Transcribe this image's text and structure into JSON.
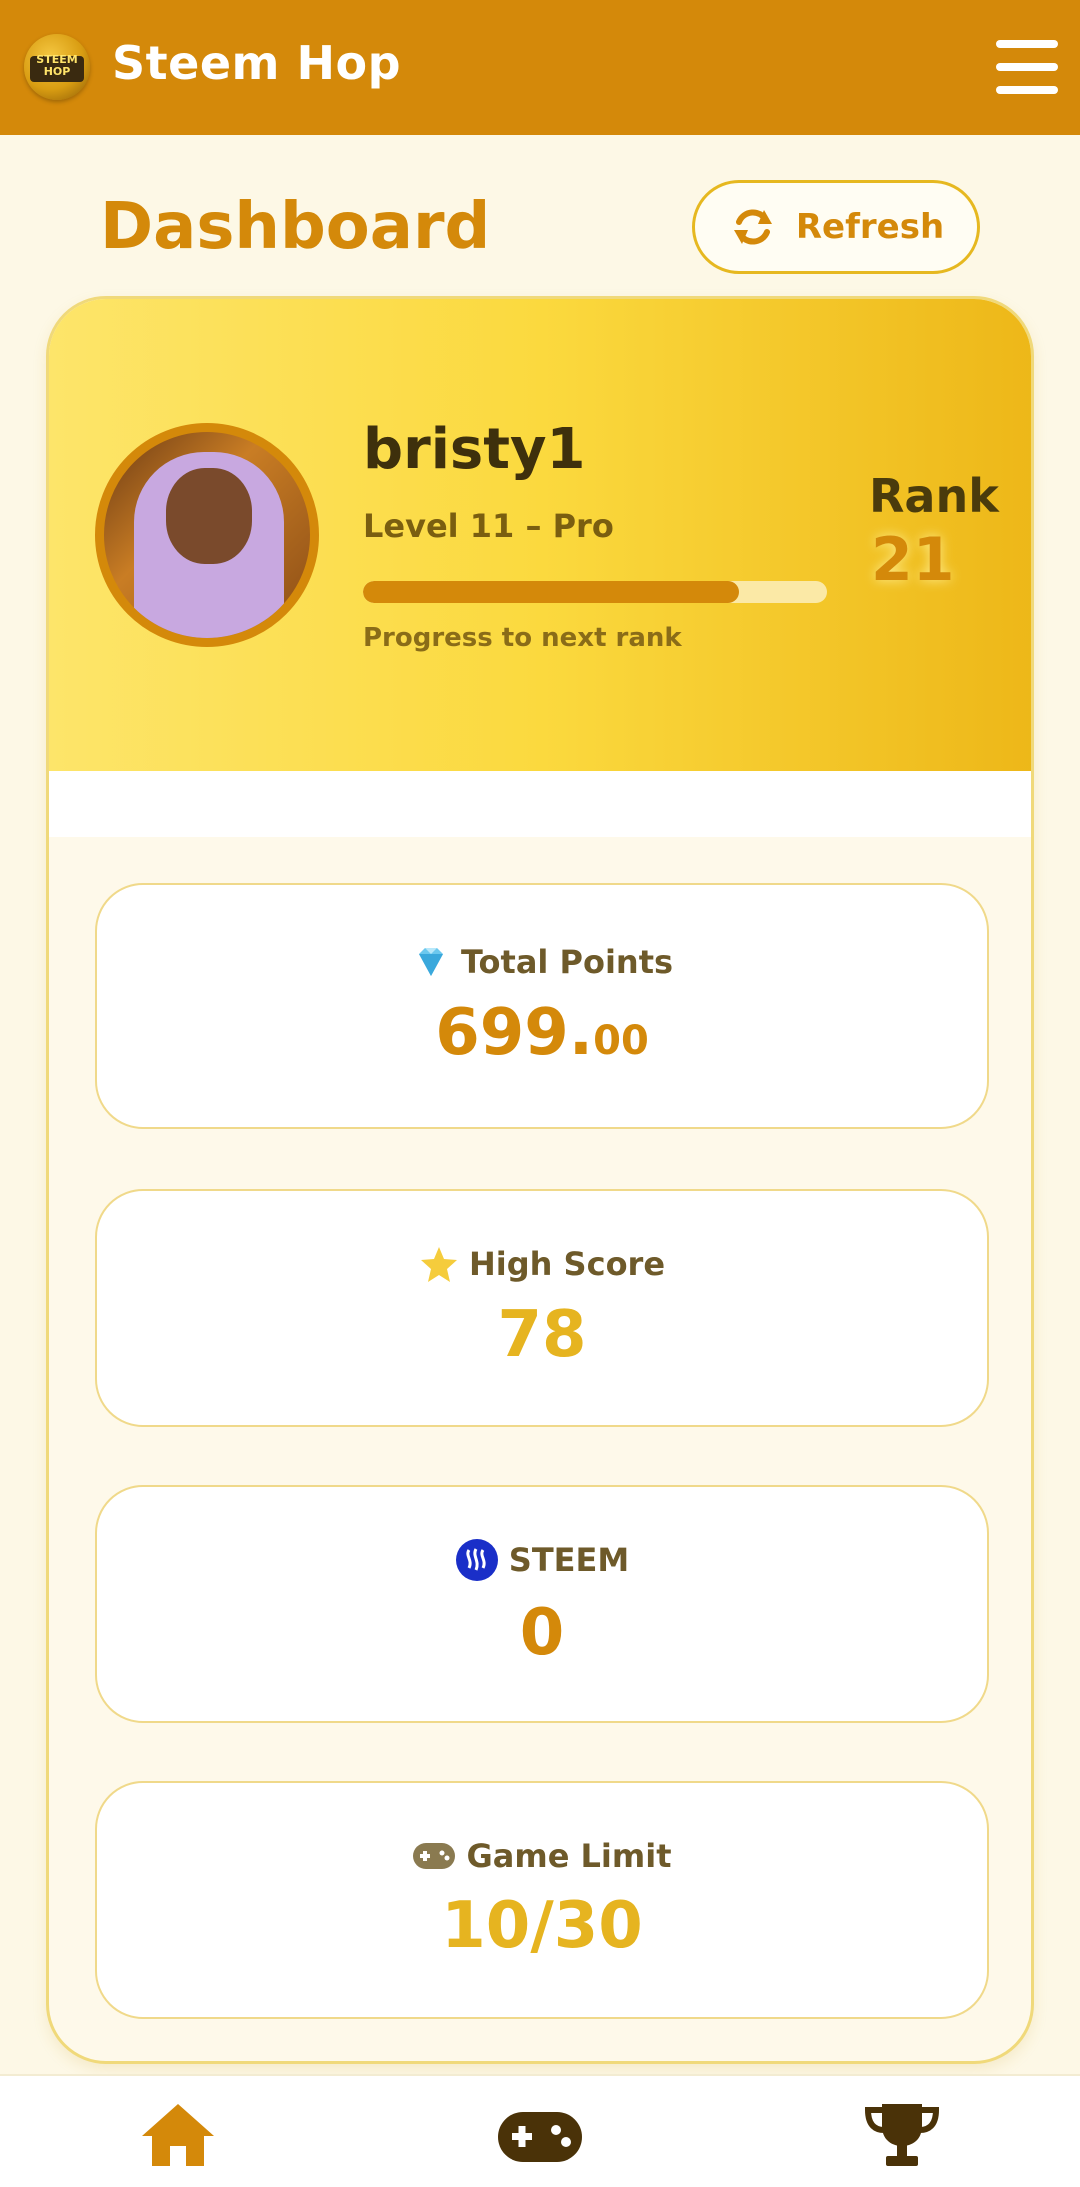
{
  "app": {
    "title": "Steem Hop",
    "logo_text": "STEEM HOP"
  },
  "header": {
    "page_title": "Dashboard",
    "refresh_label": "Refresh"
  },
  "profile": {
    "username": "bristy1",
    "level": "Level 11 – Pro",
    "progress_label": "Progress to next rank",
    "progress_fraction": 0.81,
    "rank_label": "Rank",
    "rank_value": "21"
  },
  "stats": [
    {
      "icon": "gem-icon",
      "label": "Total Points",
      "value_main": "699.",
      "value_decimal": "00"
    },
    {
      "icon": "star-icon",
      "label": "High Score",
      "value": "78"
    },
    {
      "icon": "steem-icon",
      "label": "STEEM",
      "value": "0"
    },
    {
      "icon": "gamepad-icon",
      "label": "Game Limit",
      "value": "10/30"
    }
  ],
  "nav": [
    "home-icon",
    "gamepad-icon",
    "trophy-icon"
  ],
  "colors": {
    "primary": "#d4890a",
    "gold": "#e6b420",
    "background": "#fdf8e6",
    "dark": "#4a3b0c"
  }
}
